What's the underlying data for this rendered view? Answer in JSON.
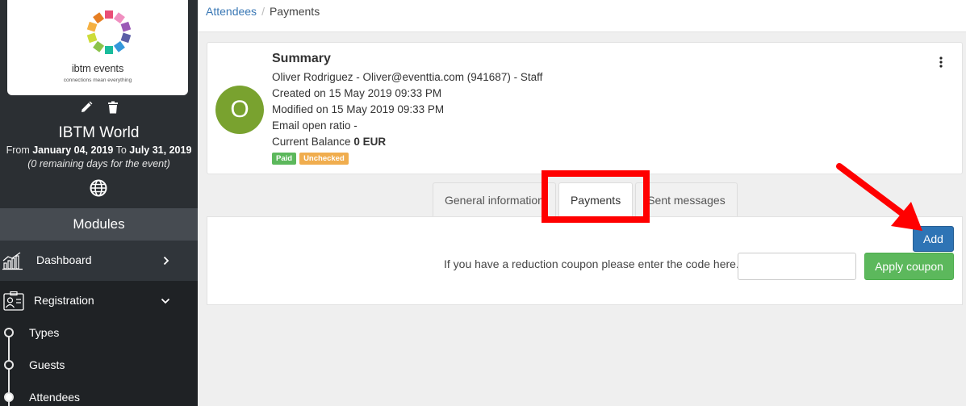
{
  "sidebar": {
    "logo_brand": "ibtm events",
    "logo_tagline": "connections mean everything",
    "event_title": "IBTM World",
    "dates": {
      "from_label": "From",
      "from_date": "January 04, 2019",
      "to_label": "To",
      "to_date": "July 31, 2019",
      "remaining": "(0 remaining days for the event)"
    },
    "modules_label": "Modules",
    "nav": {
      "dashboard": "Dashboard",
      "registration": "Registration",
      "sub_items": [
        "Types",
        "Guests",
        "Attendees"
      ]
    }
  },
  "breadcrumb": {
    "parent": "Attendees",
    "separator": "/",
    "current": "Payments"
  },
  "summary": {
    "title": "Summary",
    "avatar_letter": "O",
    "person_line": "Oliver Rodriguez - Oliver@eventtia.com (941687) - Staff",
    "created": "Created on 15 May 2019 09:33 PM",
    "modified": "Modified on 15 May 2019 09:33 PM",
    "email_open_ratio": "Email open ratio -",
    "balance_label": "Current Balance",
    "balance_value": "0 EUR",
    "badges": [
      "Paid",
      "Unchecked"
    ]
  },
  "tabs": [
    "General information",
    "Payments",
    "Sent messages"
  ],
  "payments": {
    "add_label": "Add",
    "coupon_prompt": "If you have a reduction coupon please enter the code here.",
    "coupon_value": "",
    "apply_label": "Apply coupon"
  },
  "colors": {
    "sidebar_bg": "#2b2f33",
    "avatar_green": "#79a22f",
    "primary_blue": "#2e74b5",
    "success_green": "#5cb85c",
    "warning_orange": "#f0ad4e",
    "annotation_red": "#ff0000"
  },
  "icons": [
    "pencil-icon",
    "trash-icon",
    "globe-icon",
    "chart-icon",
    "id-card-icon",
    "chevron-right-icon",
    "chevron-down-icon",
    "kebab-menu-icon"
  ]
}
